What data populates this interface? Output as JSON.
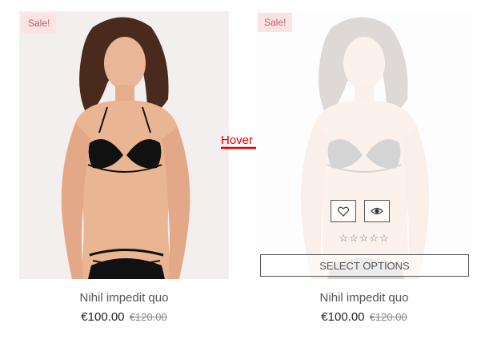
{
  "annotation": {
    "hover_label": "Hover",
    "arrow_color": "#e00000"
  },
  "cards": [
    {
      "state": "default",
      "badge": "Sale!",
      "name": "Nihil impedit quo",
      "price_now": "€100.00",
      "price_old": "€120.00"
    },
    {
      "state": "hover",
      "badge": "Sale!",
      "name": "Nihil impedit quo",
      "price_now": "€100.00",
      "price_old": "€120.00",
      "actions": [
        {
          "icon": "heart-icon"
        },
        {
          "icon": "eye-icon"
        }
      ],
      "rating_stars": "☆☆☆☆☆",
      "rating_value": 0,
      "select_options_label": "SELECT OPTIONS"
    }
  ],
  "colors": {
    "badge_bg": "#fbe3e3",
    "badge_text": "#b56565"
  }
}
